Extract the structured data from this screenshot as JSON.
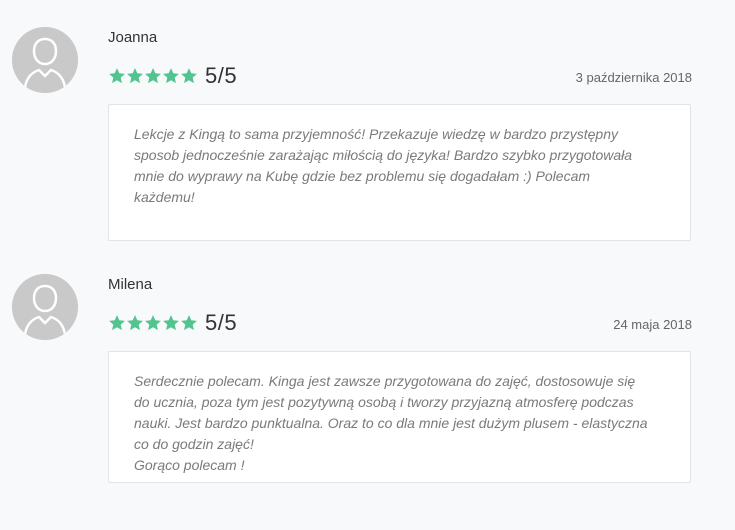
{
  "colors": {
    "star": "#52c48f",
    "avatar": "#c9c9c9"
  },
  "reviews": [
    {
      "name": "Joanna",
      "stars": 5,
      "score": "5/5",
      "date": "3 października 2018",
      "comment": "Lekcje z Kingą to sama przyjemność! Przekazuje wiedzę w bardzo przystępny\nsposob jednocześnie zarażając miłością do języka! Bardzo szybko przygotowała\nmnie do wyprawy na Kubę gdzie bez problemu się dogadałam :) Polecam\nkażdemu!",
      "avatar_icon": "user-avatar-icon"
    },
    {
      "name": "Milena",
      "stars": 5,
      "score": "5/5",
      "date": "24 maja 2018",
      "comment": "Serdecznie polecam. Kinga jest zawsze przygotowana do zajęć, dostosowuje się\ndo ucznia, poza tym jest pozytywną osobą i tworzy przyjazną atmosferę podczas\nnauki. Jest bardzo punktualna. Oraz to co dla mnie jest dużym plusem - elastyczna\nco do godzin zajęć!\nGorąco polecam !",
      "avatar_icon": "user-avatar-icon"
    }
  ]
}
